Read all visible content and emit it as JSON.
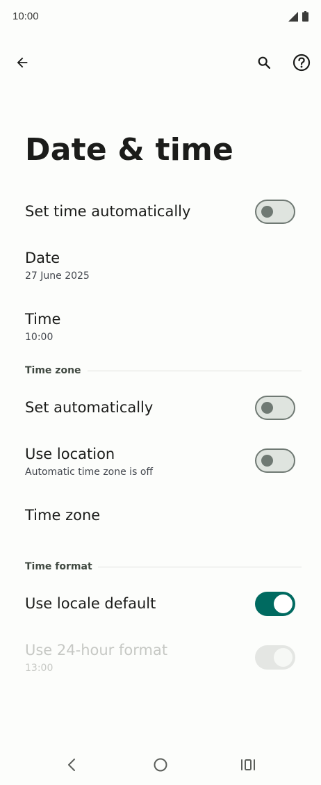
{
  "status_bar": {
    "time": "10:00",
    "icons": [
      "signal-icon",
      "battery-icon"
    ]
  },
  "app_bar": {
    "back_icon": "arrow-left-icon",
    "search_icon": "search-icon",
    "help_icon": "help-circle-icon"
  },
  "page": {
    "title": "Date & time"
  },
  "settings": {
    "set_time_auto": {
      "label": "Set time automatically",
      "enabled": false
    },
    "date": {
      "label": "Date",
      "value": "27 June 2025"
    },
    "time": {
      "label": "Time",
      "value": "10:00"
    },
    "time_zone_section": "Time zone",
    "set_tz_auto": {
      "label": "Set automatically",
      "enabled": false
    },
    "use_location": {
      "label": "Use location",
      "sub": "Automatic time zone is off",
      "enabled": false
    },
    "time_zone": {
      "label": "Time zone"
    },
    "time_format_section": "Time format",
    "use_locale_default": {
      "label": "Use locale default",
      "enabled": true
    },
    "use_24_hour": {
      "label": "Use 24-hour format",
      "sub": "13:00",
      "enabled": true,
      "disabled": true
    }
  },
  "colors": {
    "accent": "#006a60",
    "switch_off_track": "#dfe4df",
    "switch_off_outline": "#6f7973",
    "disabled_text": "#c6c8c4"
  },
  "nav_bar": {
    "icons": [
      "nav-back-icon",
      "nav-home-icon",
      "nav-recents-icon"
    ]
  }
}
